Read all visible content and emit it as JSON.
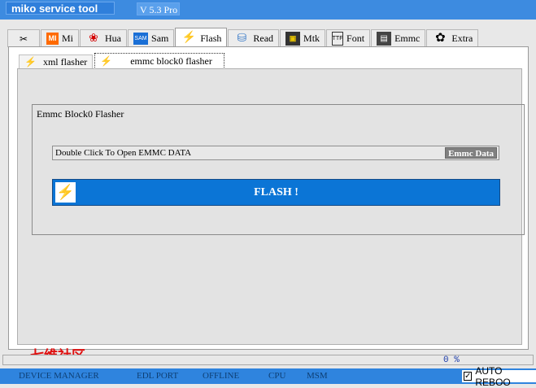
{
  "window": {
    "title": "miko service tool",
    "version": "V 5.3 Pro"
  },
  "main_tabs": [
    {
      "label": "",
      "icon": "tools-icon",
      "glyph": "✂"
    },
    {
      "label": "Mi",
      "icon": "mi-icon",
      "glyph": "MI"
    },
    {
      "label": "Hua",
      "icon": "huawei-icon",
      "glyph": "❀"
    },
    {
      "label": "Sam",
      "icon": "samsung-icon",
      "glyph": "SAM"
    },
    {
      "label": "Flash",
      "icon": "lightning-icon",
      "glyph": "⚡"
    },
    {
      "label": "Read",
      "icon": "database-icon",
      "glyph": "⛁"
    },
    {
      "label": "Mtk",
      "icon": "chip-icon",
      "glyph": "▣"
    },
    {
      "label": "Font",
      "icon": "font-file-icon",
      "glyph": "TTF"
    },
    {
      "label": "Emmc",
      "icon": "emmc-chip-icon",
      "glyph": "▤"
    },
    {
      "label": "Extra",
      "icon": "dte-icon",
      "glyph": "✿"
    }
  ],
  "sub_tabs": [
    {
      "label": "xml flasher",
      "icon": "lightning-icon",
      "glyph": "⚡"
    },
    {
      "label": "emmc block0 flasher",
      "icon": "lightning-icon",
      "glyph": "⚡"
    }
  ],
  "group": {
    "title": "Emmc Block0 Flasher",
    "field_text": "Double Click To Open EMMC DATA",
    "emmc_button": "Emmc Data",
    "flash_button": "FLASH !",
    "flash_glyph": "⚡"
  },
  "progress": {
    "text": "0 %",
    "value": 0
  },
  "watermark": "七维社区",
  "status": {
    "device_manager": "DEVICE MANAGER",
    "edl_port": "EDL PORT",
    "offline": "OFFLINE",
    "cpu": "CPU",
    "msm": "MSM",
    "auto_reboot": "AUTO REBOO",
    "auto_reboot_checked": true,
    "check_glyph": "✓"
  },
  "colors": {
    "titlebar": "#3d8be0",
    "flash_button": "#0b75d6",
    "statusbar": "#2f84de",
    "watermark": "#e01010"
  }
}
